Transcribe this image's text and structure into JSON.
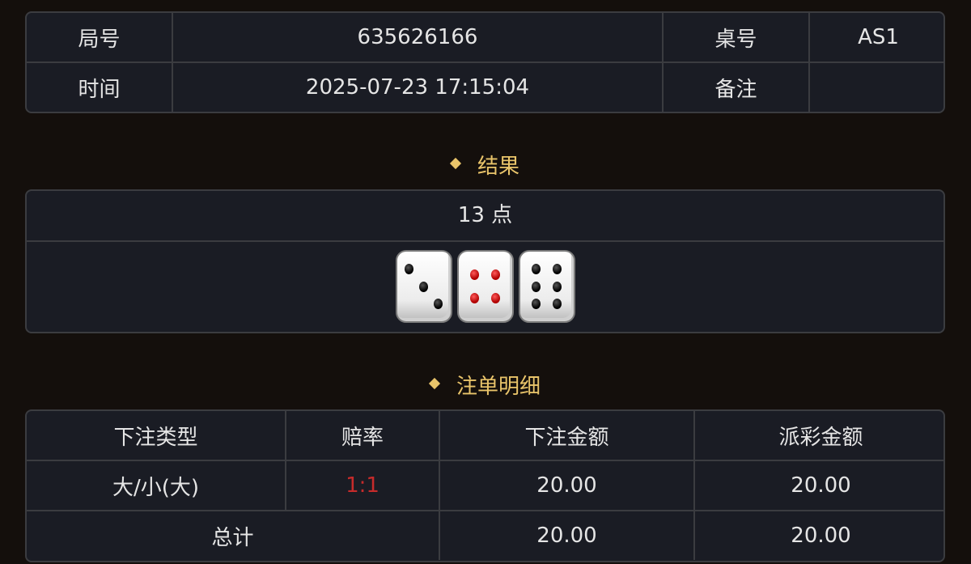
{
  "round_info": {
    "round_label": "局号",
    "round_value": "635626166",
    "table_label": "桌号",
    "table_value": "AS1",
    "time_label": "时间",
    "time_value": "2025-07-23 17:15:04",
    "remark_label": "备注",
    "remark_value": ""
  },
  "result": {
    "section_title": "结果",
    "points_text": "13 点",
    "dice": [
      {
        "value": 3,
        "icon": "dice-three-icon",
        "pip_color": "#000000"
      },
      {
        "value": 4,
        "icon": "dice-four-icon",
        "pip_color": "#c00000"
      },
      {
        "value": 6,
        "icon": "dice-six-icon",
        "pip_color": "#000000"
      }
    ]
  },
  "bet_details": {
    "section_title": "注单明细",
    "headers": [
      "下注类型",
      "赔率",
      "下注金额",
      "派彩金额"
    ],
    "rows": [
      {
        "bet_type": "大/小(大)",
        "odds": "1:1",
        "bet_amount": "20.00",
        "payout": "20.00"
      }
    ],
    "total": {
      "label": "总计",
      "bet_amount": "20.00",
      "payout": "20.00"
    }
  },
  "colors": {
    "background": "#140f0c",
    "card_background": "#1a1c24",
    "border": "#3b3c40",
    "accent_gold": "#e9c46a",
    "odds_red": "#c62b2b"
  }
}
